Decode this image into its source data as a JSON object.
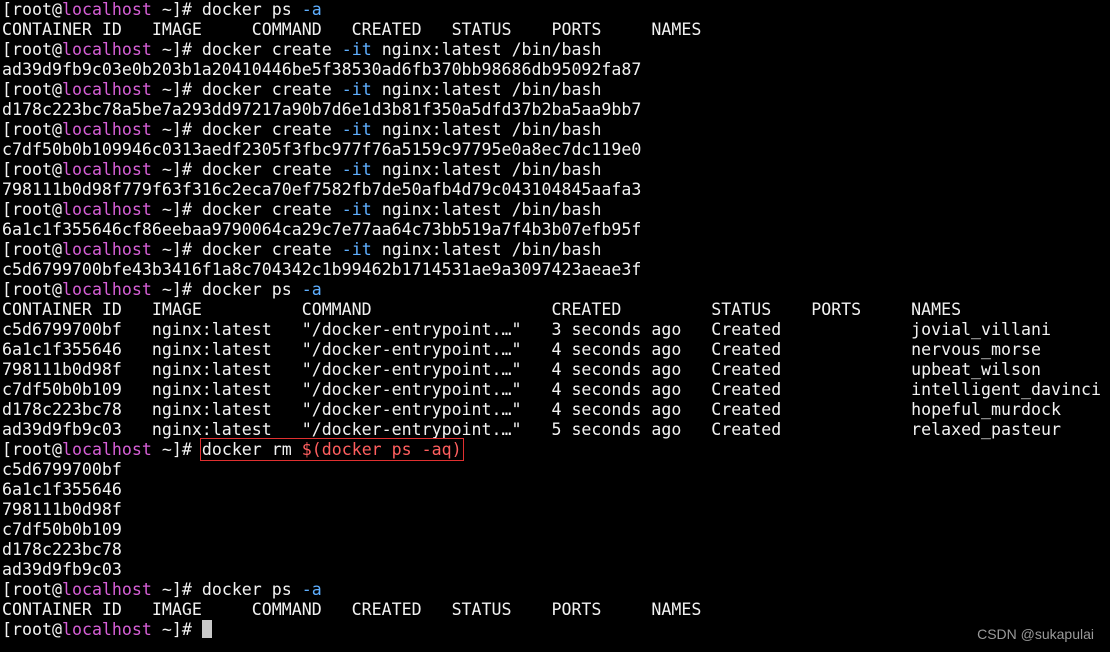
{
  "prompt": {
    "open_bracket": "[",
    "user": "root",
    "at": "@",
    "host": "localhost",
    "cwd_close": " ~]# "
  },
  "colors": {
    "background": "#000000",
    "foreground": "#f2f2f2",
    "host": "#d75fd7",
    "flag": "#5fafff",
    "highlight_box": "#e03030",
    "substitution": "#ff5f5f",
    "watermark": "#9a9a9a"
  },
  "lines": [
    {
      "type": "prompt",
      "cmd": "docker ps ",
      "flag": "-a",
      "rest": ""
    },
    {
      "type": "output",
      "text": "CONTAINER ID   IMAGE     COMMAND   CREATED   STATUS    PORTS     NAMES"
    },
    {
      "type": "prompt",
      "cmd": "docker create ",
      "flag": "-it",
      "rest": " nginx:latest /bin/bash"
    },
    {
      "type": "output",
      "text": "ad39d9fb9c03e0b203b1a20410446be5f38530ad6fb370bb98686db95092fa87"
    },
    {
      "type": "prompt",
      "cmd": "docker create ",
      "flag": "-it",
      "rest": " nginx:latest /bin/bash"
    },
    {
      "type": "output",
      "text": "d178c223bc78a5be7a293dd97217a90b7d6e1d3b81f350a5dfd37b2ba5aa9bb7"
    },
    {
      "type": "prompt",
      "cmd": "docker create ",
      "flag": "-it",
      "rest": " nginx:latest /bin/bash"
    },
    {
      "type": "output",
      "text": "c7df50b0b109946c0313aedf2305f3fbc977f76a5159c97795e0a8ec7dc119e0"
    },
    {
      "type": "prompt",
      "cmd": "docker create ",
      "flag": "-it",
      "rest": " nginx:latest /bin/bash"
    },
    {
      "type": "output",
      "text": "798111b0d98f779f63f316c2eca70ef7582fb7de50afb4d79c043104845aafa3"
    },
    {
      "type": "prompt",
      "cmd": "docker create ",
      "flag": "-it",
      "rest": " nginx:latest /bin/bash"
    },
    {
      "type": "output",
      "text": "6a1c1f355646cf86eebaa9790064ca29c7e77aa64c73bb519a7f4b3b07efb95f"
    },
    {
      "type": "prompt",
      "cmd": "docker create ",
      "flag": "-it",
      "rest": " nginx:latest /bin/bash"
    },
    {
      "type": "output",
      "text": "c5d6799700bfe43b3416f1a8c704342c1b99462b1714531ae9a3097423aeae3f"
    },
    {
      "type": "prompt",
      "cmd": "docker ps ",
      "flag": "-a",
      "rest": ""
    },
    {
      "type": "output",
      "text": "CONTAINER ID   IMAGE          COMMAND                  CREATED         STATUS    PORTS     NAMES"
    },
    {
      "type": "output",
      "text": "c5d6799700bf   nginx:latest   \"/docker-entrypoint.…\"   3 seconds ago   Created             jovial_villani"
    },
    {
      "type": "output",
      "text": "6a1c1f355646   nginx:latest   \"/docker-entrypoint.…\"   4 seconds ago   Created             nervous_morse"
    },
    {
      "type": "output",
      "text": "798111b0d98f   nginx:latest   \"/docker-entrypoint.…\"   4 seconds ago   Created             upbeat_wilson"
    },
    {
      "type": "output",
      "text": "c7df50b0b109   nginx:latest   \"/docker-entrypoint.…\"   4 seconds ago   Created             intelligent_davinci"
    },
    {
      "type": "output",
      "text": "d178c223bc78   nginx:latest   \"/docker-entrypoint.…\"   4 seconds ago   Created             hopeful_murdock"
    },
    {
      "type": "output",
      "text": "ad39d9fb9c03   nginx:latest   \"/docker-entrypoint.…\"   5 seconds ago   Created             relaxed_pasteur"
    },
    {
      "type": "prompt-highlight",
      "cmd": "docker rm ",
      "subst": "$(docker ps -aq)"
    },
    {
      "type": "output",
      "text": "c5d6799700bf"
    },
    {
      "type": "output",
      "text": "6a1c1f355646"
    },
    {
      "type": "output",
      "text": "798111b0d98f"
    },
    {
      "type": "output",
      "text": "c7df50b0b109"
    },
    {
      "type": "output",
      "text": "d178c223bc78"
    },
    {
      "type": "output",
      "text": "ad39d9fb9c03"
    },
    {
      "type": "prompt",
      "cmd": "docker ps ",
      "flag": "-a",
      "rest": ""
    },
    {
      "type": "output",
      "text": "CONTAINER ID   IMAGE     COMMAND   CREATED   STATUS    PORTS     NAMES"
    },
    {
      "type": "prompt-cursor",
      "cmd": ""
    }
  ],
  "watermark": "CSDN @sukapulai"
}
